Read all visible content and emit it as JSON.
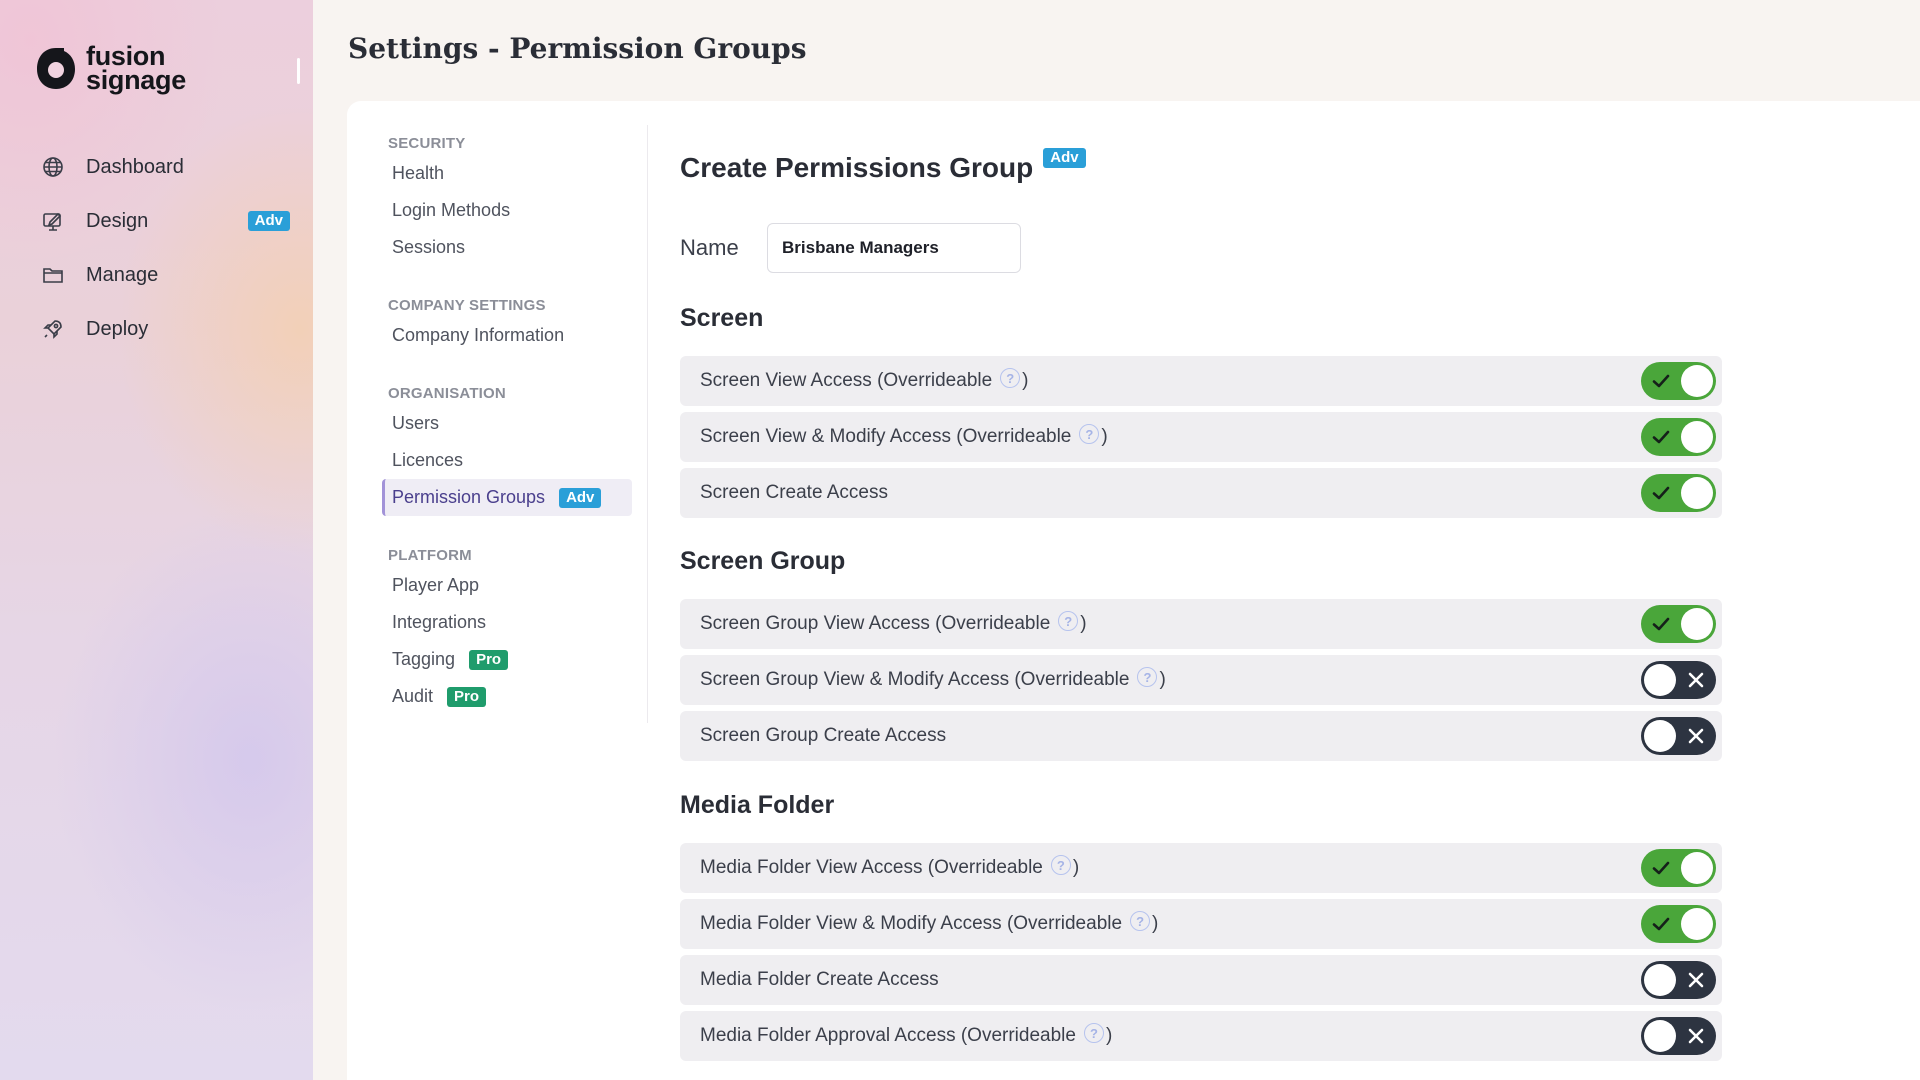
{
  "app": {
    "logo": {
      "line1": "fusion",
      "line2": "signage"
    },
    "nav": [
      {
        "label": "Dashboard",
        "icon": "globe-icon",
        "badge": ""
      },
      {
        "label": "Design",
        "icon": "design-icon",
        "badge": "Adv"
      },
      {
        "label": "Manage",
        "icon": "folder-icon",
        "badge": ""
      },
      {
        "label": "Deploy",
        "icon": "rocket-icon",
        "badge": ""
      }
    ]
  },
  "header": {
    "title": "Settings - Permission Groups"
  },
  "settings_nav": {
    "sections": [
      {
        "title": "SECURITY",
        "items": [
          {
            "label": "Health"
          },
          {
            "label": "Login Methods"
          },
          {
            "label": "Sessions"
          }
        ]
      },
      {
        "title": "COMPANY SETTINGS",
        "items": [
          {
            "label": "Company Information"
          }
        ]
      },
      {
        "title": "ORGANISATION",
        "items": [
          {
            "label": "Users"
          },
          {
            "label": "Licences"
          },
          {
            "label": "Permission Groups",
            "badge": "Adv",
            "active": true
          }
        ]
      },
      {
        "title": "PLATFORM",
        "items": [
          {
            "label": "Player App"
          },
          {
            "label": "Integrations"
          },
          {
            "label": "Tagging",
            "badge": "Pro"
          },
          {
            "label": "Audit",
            "badge": "Pro"
          }
        ]
      }
    ]
  },
  "form": {
    "title": "Create Permissions Group",
    "title_badge": "Adv",
    "name_label": "Name",
    "name_value": "Brisbane Managers",
    "groups": [
      {
        "title": "Screen",
        "permissions": [
          {
            "label": "Screen View Access (Overrideable",
            "help": true,
            "enabled": true
          },
          {
            "label": "Screen View & Modify Access (Overrideable",
            "help": true,
            "enabled": true
          },
          {
            "label": "Screen Create Access",
            "help": false,
            "enabled": true
          }
        ]
      },
      {
        "title": "Screen Group",
        "permissions": [
          {
            "label": "Screen Group View Access (Overrideable",
            "help": true,
            "enabled": true
          },
          {
            "label": "Screen Group View & Modify Access (Overrideable",
            "help": true,
            "enabled": false
          },
          {
            "label": "Screen Group Create Access",
            "help": false,
            "enabled": false
          }
        ]
      },
      {
        "title": "Media Folder",
        "permissions": [
          {
            "label": "Media Folder View Access (Overrideable",
            "help": true,
            "enabled": true
          },
          {
            "label": "Media Folder View & Modify Access (Overrideable",
            "help": true,
            "enabled": true
          },
          {
            "label": "Media Folder Create Access",
            "help": false,
            "enabled": false
          },
          {
            "label": "Media Folder Approval Access (Overrideable",
            "help": true,
            "enabled": false
          }
        ]
      }
    ]
  },
  "colors": {
    "toggle_on": "#4aa63a",
    "toggle_off": "#2d3441",
    "adv_badge": "#2a9fd8",
    "pro_badge": "#1f9c6c",
    "active_nav": "#4a3f8d"
  }
}
